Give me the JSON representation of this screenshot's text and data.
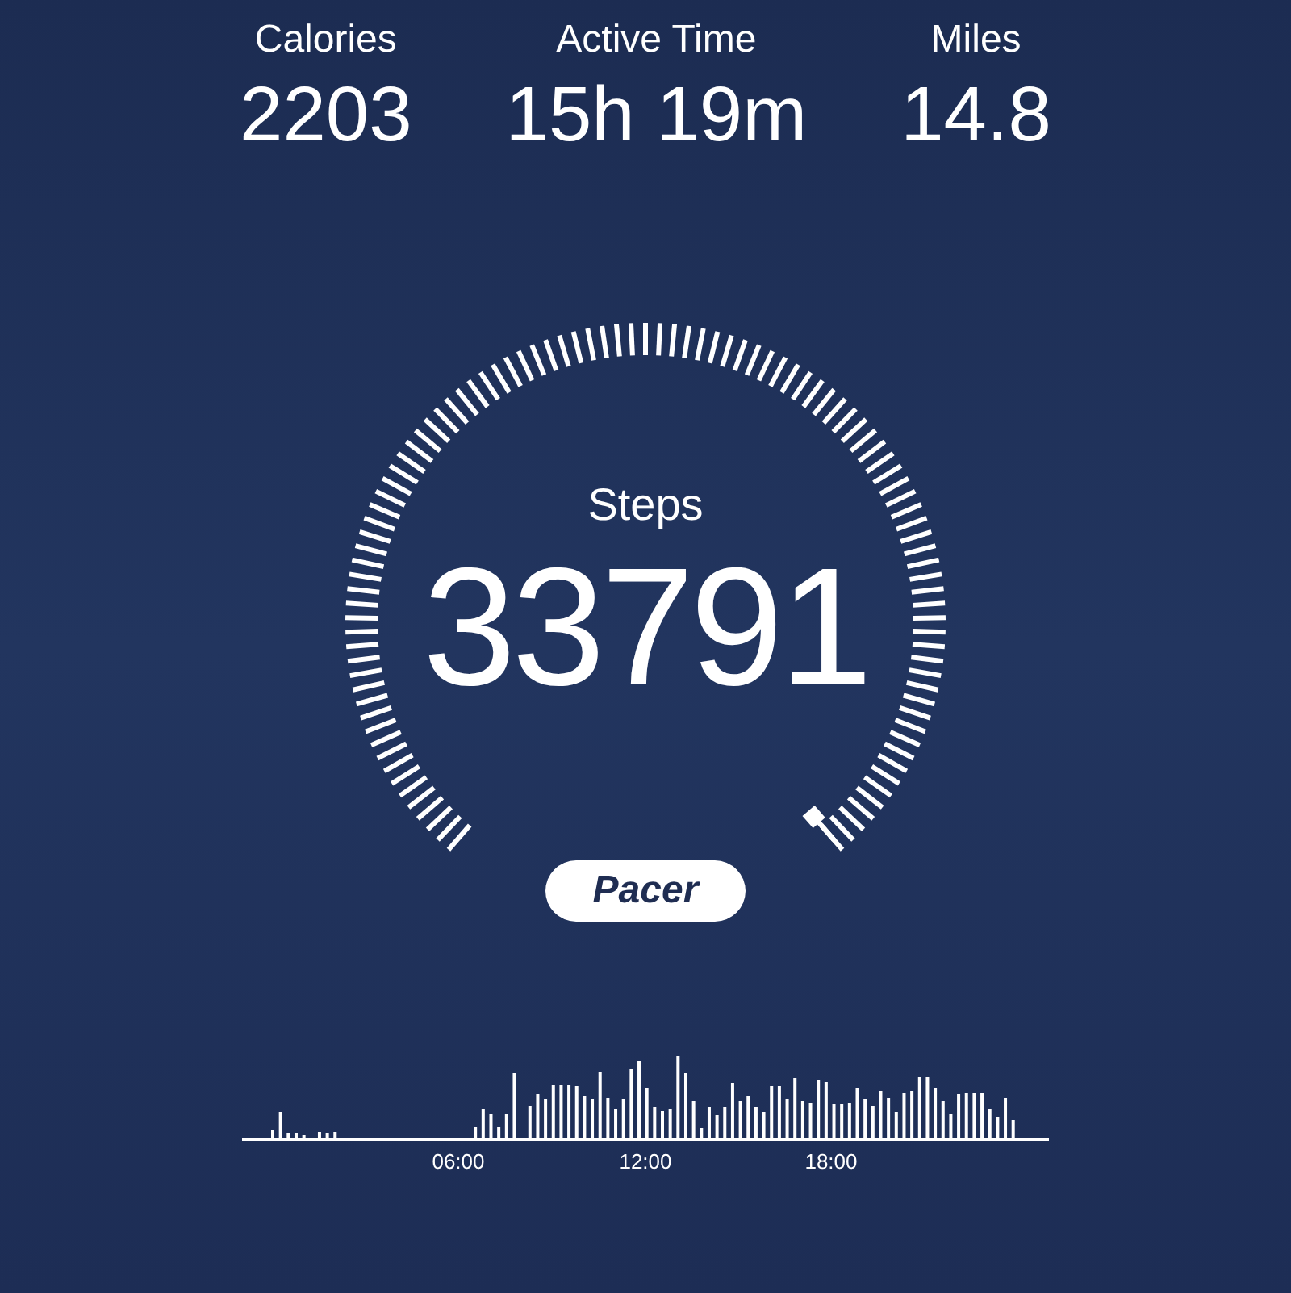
{
  "stats": [
    {
      "label": "Calories",
      "value": "2203"
    },
    {
      "label": "Active Time",
      "value": "15h 19m"
    },
    {
      "label": "Miles",
      "value": "14.8"
    }
  ],
  "gauge": {
    "label": "Steps",
    "value": "33791"
  },
  "brand": "Pacer",
  "activity_chart": {
    "time_labels": [
      "06:00",
      "12:00",
      "18:00"
    ]
  }
}
